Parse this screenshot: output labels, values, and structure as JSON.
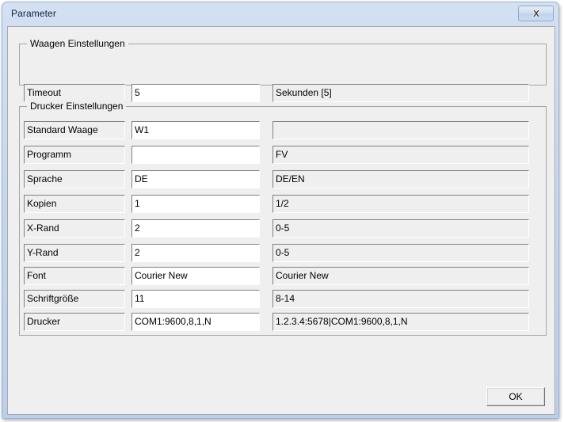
{
  "window": {
    "title": "Parameter",
    "close_icon": "close-x-icon"
  },
  "groups": {
    "waagen": {
      "caption": "Waagen Einstellungen",
      "rows": [
        {
          "label": "Timeout",
          "value": "5",
          "hint": "Sekunden [5]"
        }
      ]
    },
    "drucker": {
      "caption": "Drucker Einstellungen",
      "rows": [
        {
          "label": "Standard Waage",
          "value": "W1",
          "hint": ""
        },
        {
          "label": "Programm",
          "value": "",
          "hint": "FV"
        },
        {
          "label": "Sprache",
          "value": "DE",
          "hint": "DE/EN"
        },
        {
          "label": "Kopien",
          "value": "1",
          "hint": "1/2"
        },
        {
          "label": "X-Rand",
          "value": "2",
          "hint": "0-5"
        },
        {
          "label": "Y-Rand",
          "value": "2",
          "hint": "0-5"
        },
        {
          "label": "Font",
          "value": "Courier New",
          "hint": "Courier New"
        },
        {
          "label": "Schriftgröße",
          "value": "11",
          "hint": "8-14"
        },
        {
          "label": "Drucker",
          "value": "COM1:9600,8,1,N",
          "hint": "1.2.3.4:5678|COM1:9600,8,1,N"
        }
      ]
    }
  },
  "buttons": {
    "ok_label": "OK"
  },
  "colors": {
    "frame": "#c3d6ef",
    "client_bg": "#efefef",
    "field_border_dark": "#808080",
    "group_border": "#a4a4a4"
  }
}
